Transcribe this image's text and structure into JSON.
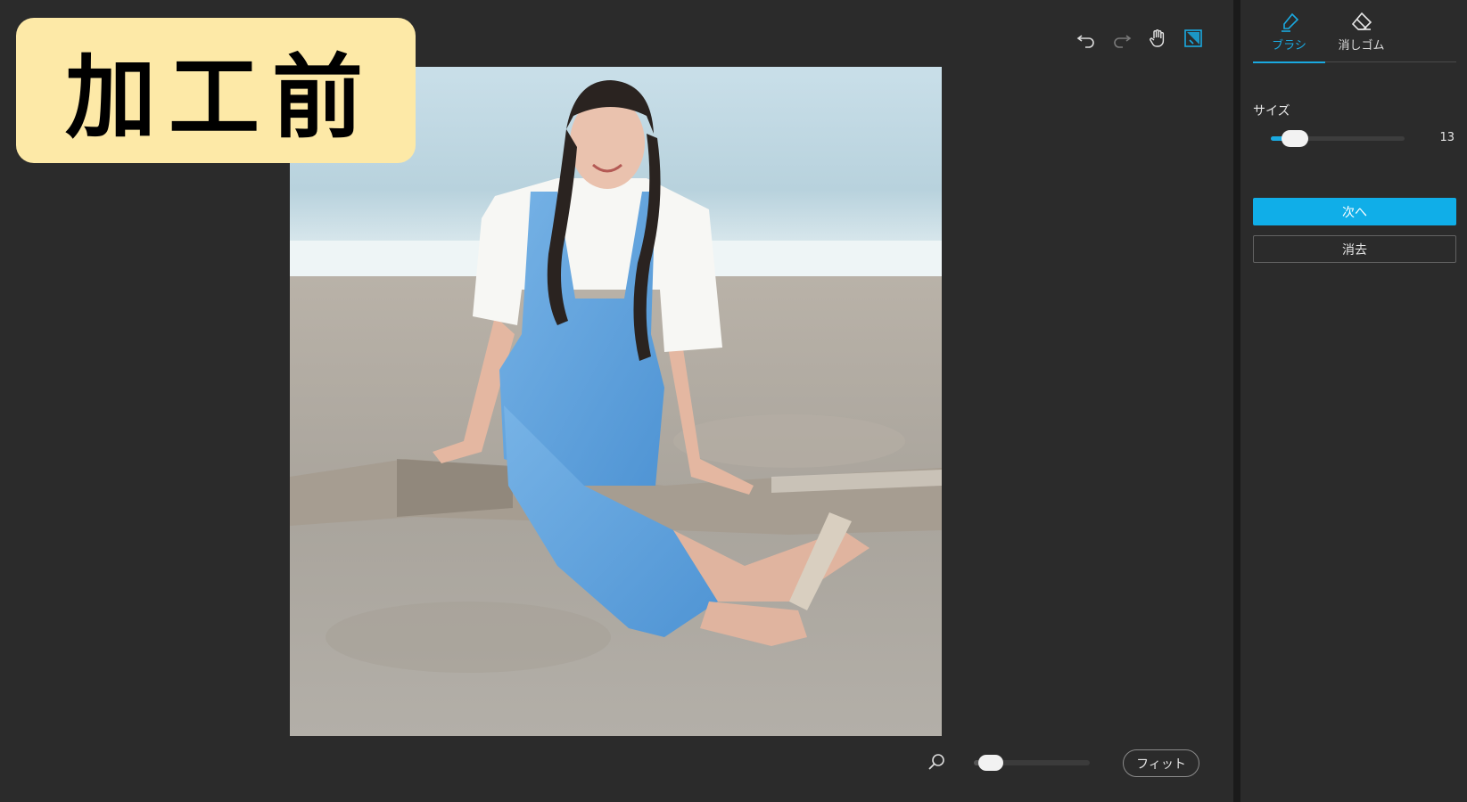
{
  "badge": {
    "text": "加工前"
  },
  "toolbar": {
    "items": [
      {
        "icon": "undo-icon"
      },
      {
        "icon": "redo-icon"
      },
      {
        "icon": "hand-pan-icon"
      },
      {
        "icon": "brush-select-icon",
        "active": true
      }
    ]
  },
  "image": {
    "description_icon": "photo-canvas"
  },
  "zoom": {
    "level_fraction": 0.05
  },
  "fit": {
    "label": "フィット"
  },
  "panel": {
    "tabs": [
      {
        "label": "ブラシ",
        "icon": "brush-icon",
        "active": true
      },
      {
        "label": "消しゴム",
        "icon": "eraser-icon",
        "active": false
      }
    ],
    "size": {
      "label": "サイズ",
      "value": "13",
      "fraction": 0.1
    },
    "next_label": "次へ",
    "clear_label": "消去"
  },
  "colors": {
    "accent": "#1aa9e0",
    "primary_button": "#10aee8",
    "badge_bg": "#fde9a7",
    "background": "#2b2b2b"
  }
}
